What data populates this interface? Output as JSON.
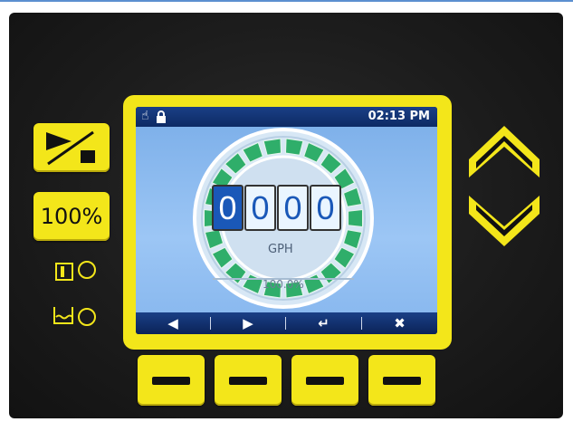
{
  "status_bar": {
    "time": "02:13 PM",
    "icons": [
      "hand-icon",
      "lock-icon"
    ]
  },
  "flow_display": {
    "digits": [
      "0",
      "0",
      "0",
      "0"
    ],
    "unit": "GPH",
    "percent": "100.0%"
  },
  "nav_bar": {
    "left": "◀",
    "right": "▶",
    "enter": "↵",
    "cancel": "✖"
  },
  "left_keys": {
    "percent_button": "100%"
  },
  "colors": {
    "accent_yellow": "#f3e61a",
    "screen_blue": "#1a3f86",
    "ring_green": "#2fae6a"
  }
}
